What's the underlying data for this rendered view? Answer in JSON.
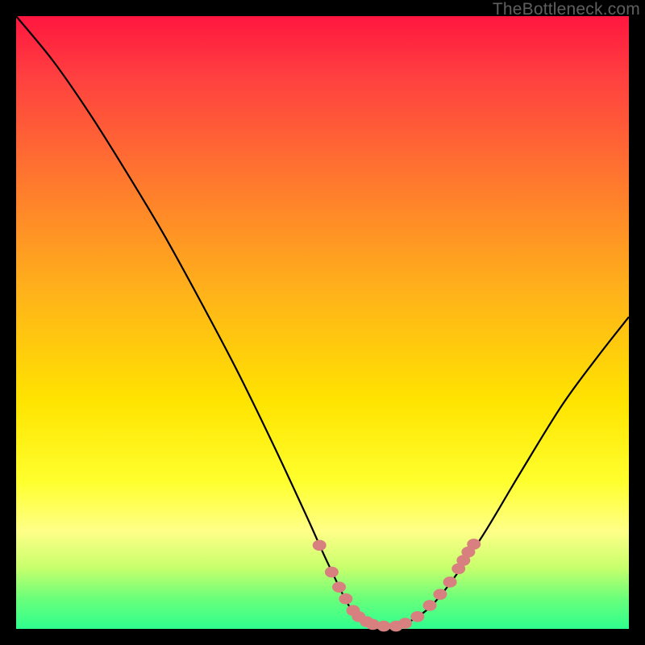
{
  "watermark": "TheBottleneck.com",
  "colors": {
    "background": "#000000",
    "curve": "#000000",
    "marker_fill": "#d88080",
    "marker_stroke": "#b05858"
  },
  "chart_data": {
    "type": "line",
    "title": "",
    "xlabel": "",
    "ylabel": "",
    "xlim": [
      0,
      100
    ],
    "ylim": [
      0,
      110
    ],
    "x": [
      0,
      6,
      12,
      18,
      24,
      30,
      36,
      42,
      47.5,
      51,
      55,
      58.5,
      62,
      66,
      70,
      76,
      82,
      89,
      95,
      100
    ],
    "y": [
      110,
      102,
      92.5,
      82,
      71,
      59,
      46.5,
      33,
      20,
      11.5,
      3,
      0.5,
      0.5,
      2.5,
      7,
      16.5,
      27.5,
      40,
      49,
      56
    ],
    "annotations": "none",
    "series": [
      {
        "name": "bottleneck-markers",
        "x": [
          49.5,
          51.5,
          52.7,
          53.8,
          55.0,
          55.9,
          57.2,
          58.2,
          60.0,
          62.0,
          63.5,
          65.5,
          67.5,
          69.2,
          70.8,
          72.2,
          73.0,
          73.8,
          74.7
        ],
        "y": [
          15.0,
          10.2,
          7.5,
          5.4,
          3.3,
          2.2,
          1.3,
          0.8,
          0.5,
          0.5,
          1.0,
          2.2,
          4.2,
          6.2,
          8.4,
          10.8,
          12.3,
          13.8,
          15.2
        ]
      }
    ]
  }
}
